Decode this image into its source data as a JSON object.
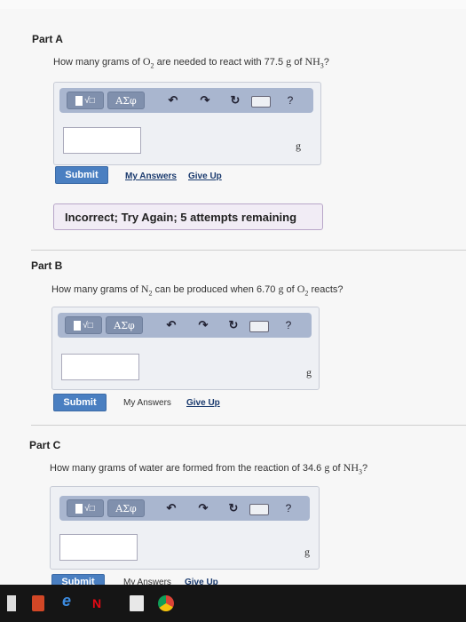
{
  "part_a": {
    "title": "Part A",
    "question_pre": "How many grams of ",
    "q_o": "O",
    "q_o_sub": "2",
    "question_mid": " are needed to react with 77.5 ",
    "q_g": "g",
    "q_of": " of ",
    "q_nh": "NH",
    "q_nh_sub": "3",
    "q_end": "?",
    "unit": "g",
    "input_value": "",
    "submit": "Submit",
    "my_answers": "My Answers",
    "give_up": "Give Up",
    "feedback": "Incorrect; Try Again; 5 attempts remaining"
  },
  "part_b": {
    "title": "Part B",
    "question_pre": "How many grams of ",
    "q_n": "N",
    "q_n_sub": "2",
    "question_mid": " can be produced when 6.70 ",
    "q_g": "g",
    "q_of": " of ",
    "q_o": "O",
    "q_o_sub": "2",
    "q_end": " reacts?",
    "unit": "g",
    "input_value": "",
    "submit": "Submit",
    "my_answers": "My Answers",
    "give_up": "Give Up"
  },
  "part_c": {
    "title": "Part C",
    "question_pre": "How many grams of water are formed from the reaction of 34.6 ",
    "q_g": "g",
    "q_of": " of ",
    "q_nh": "NH",
    "q_nh_sub": "3",
    "q_end": "?",
    "unit": "g",
    "input_value": "",
    "submit": "Submit",
    "my_answers": "My Answers",
    "give_up": "Give Up"
  },
  "toolbar": {
    "template_label": "√□",
    "greek_label": "ΑΣφ",
    "undo_icon": "undo-icon",
    "redo_icon": "redo-icon",
    "reset_icon": "reset-icon",
    "keyboard_icon": "keyboard-icon",
    "help_label": "?"
  },
  "taskbar": {
    "icons": [
      "store-icon",
      "powerpoint-icon",
      "edge-icon",
      "netflix-icon",
      "mail-icon",
      "chrome-icon"
    ]
  }
}
